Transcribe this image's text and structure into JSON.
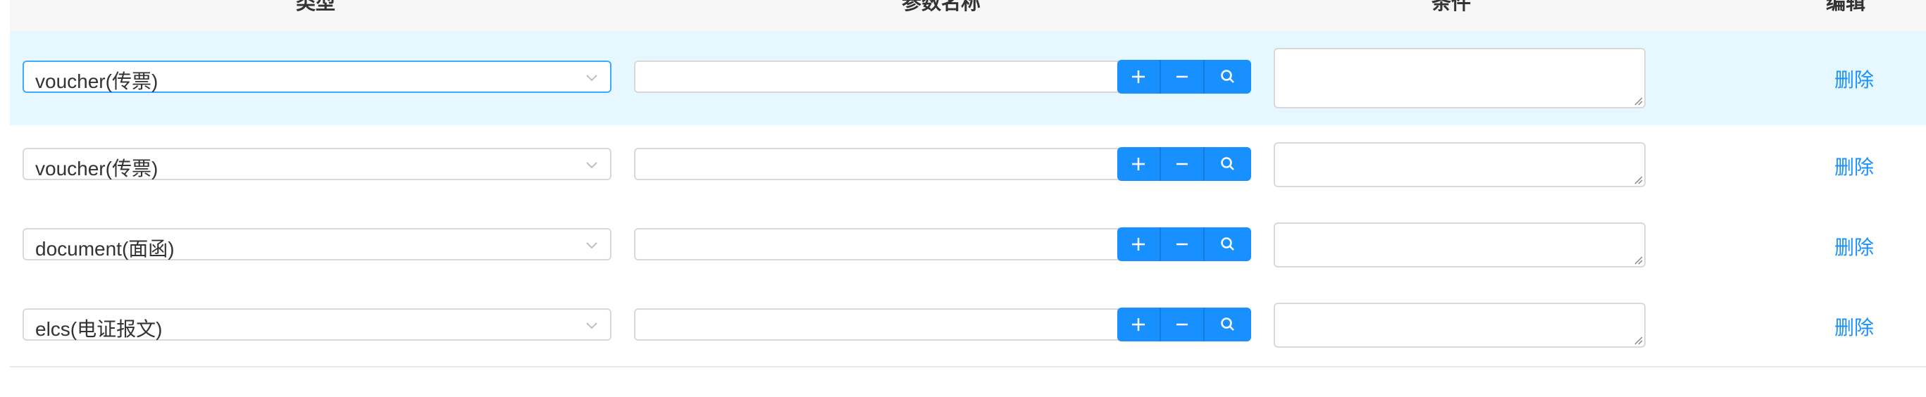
{
  "table": {
    "columns": {
      "type": "类型",
      "param_name": "参数名称",
      "condition": "条件",
      "edit": "编辑"
    },
    "rows": [
      {
        "type_value": "voucher(传票)",
        "param_value": "",
        "condition_value": "",
        "delete_label": "删除",
        "active": true
      },
      {
        "type_value": "voucher(传票)",
        "param_value": "",
        "condition_value": "",
        "delete_label": "删除",
        "active": false
      },
      {
        "type_value": "document(面函)",
        "param_value": "",
        "condition_value": "",
        "delete_label": "删除",
        "active": false
      },
      {
        "type_value": "elcs(电证报文)",
        "param_value": "",
        "condition_value": "",
        "delete_label": "删除",
        "active": false
      }
    ]
  },
  "colors": {
    "accent": "#1890ff",
    "active_row_bg": "#e6f7ff",
    "border": "#d9d9d9"
  },
  "icons": {
    "dropdown": "chevron-down-icon",
    "add": "plus-icon",
    "remove": "minus-icon",
    "search": "search-icon",
    "resize": "resize-grip-icon"
  }
}
